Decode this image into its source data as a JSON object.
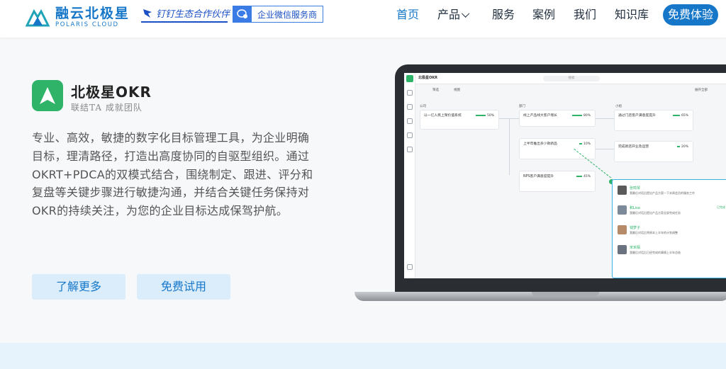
{
  "header": {
    "logo_cn": "融云北极星",
    "logo_en": "POLARIS CLOUD",
    "partner_badge": "钉钉生态合作伙伴",
    "wecom_badge": "企业微信服务商",
    "nav": [
      "首页",
      "产品",
      "服务",
      "案例",
      "我们",
      "知识库"
    ],
    "active_nav": "首页",
    "cta": "免费体验",
    "accent": "#1677c9"
  },
  "product": {
    "name": "北极星OKR",
    "slogan": "联结TA 成就团队",
    "icon": "polaris-arrow-icon",
    "icon_color": "#2eb368",
    "description": "专业、高效，敏捷的数字化目标管理工具，为企业明确目标，理清路径，打造出高度协同的自驱型组织。通过OKRT+PDCA的双模式结合，围绕制定、跟进、评分和复盘等关键步骤进行敏捷沟通，并结合关键任务保持对OKR的持续关注，为您的企业目标达成保驾护航。",
    "learn_more": "了解更多",
    "free_trial": "免费试用"
  },
  "screen": {
    "app_title": "北极星OKR",
    "search_placeholder": "搜索",
    "toolbar": [
      "筛选",
      "视图",
      "展开全部"
    ],
    "columns": [
      {
        "title": "公司",
        "cards": [
          {
            "text": "以一亿人民上架价值系统",
            "pct": "50%"
          }
        ]
      },
      {
        "title": "部门",
        "cards": [
          {
            "text": "线上产品线大客户增长",
            "pct": "80%"
          },
          {
            "text": "上半年推出多少款新品",
            "pct": "10%"
          },
          {
            "text": "NPS客户满意度提升",
            "pct": "45%"
          }
        ]
      },
      {
        "title": "小组",
        "cards": [
          {
            "text": "通过门店客户满意度提升",
            "pct": "65%"
          },
          {
            "text": "完成新店开业及运营",
            "pct": "20%"
          }
        ]
      }
    ],
    "comments": [
      {
        "name": "张鸣琴",
        "text": "我最后对话后提出产品方案一下本周会员的服务工作"
      },
      {
        "name": "和Lisa",
        "text": "我最后对话后提出产品方案全部完成任务"
      },
      {
        "name": "钱梦子",
        "text": "我最后对话后将原本上半年的计划调整"
      },
      {
        "name": "宋禾陌",
        "text": "我最后对话后已经完成的事情上半年总结"
      }
    ],
    "comment_tag": "已完成"
  }
}
